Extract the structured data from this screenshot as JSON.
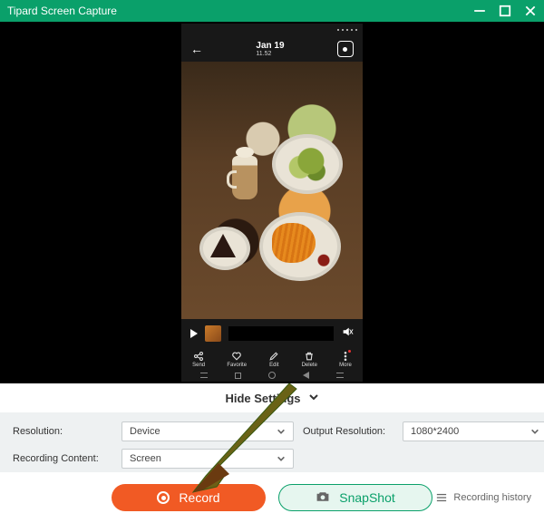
{
  "titlebar": {
    "title": "Tipard Screen Capture"
  },
  "phone": {
    "statusbar": {
      "time": ""
    },
    "header": {
      "date_line1": "Jan 19",
      "date_line2": "11.52"
    },
    "iconrow": {
      "share": "Send",
      "favorite": "Favorite",
      "edit": "Edit",
      "delete": "Delete",
      "more": "More"
    }
  },
  "toggle": {
    "label": "Hide Settings"
  },
  "settings": {
    "resolution_label": "Resolution:",
    "resolution_value": "Device",
    "recording_content_label": "Recording Content:",
    "recording_content_value": "Screen",
    "output_resolution_label": "Output Resolution:",
    "output_resolution_value": "1080*2400"
  },
  "buttons": {
    "record": "Record",
    "snapshot": "SnapShot",
    "history": "Recording history"
  },
  "colors": {
    "accent": "#0aa06a",
    "record": "#f15a24"
  }
}
